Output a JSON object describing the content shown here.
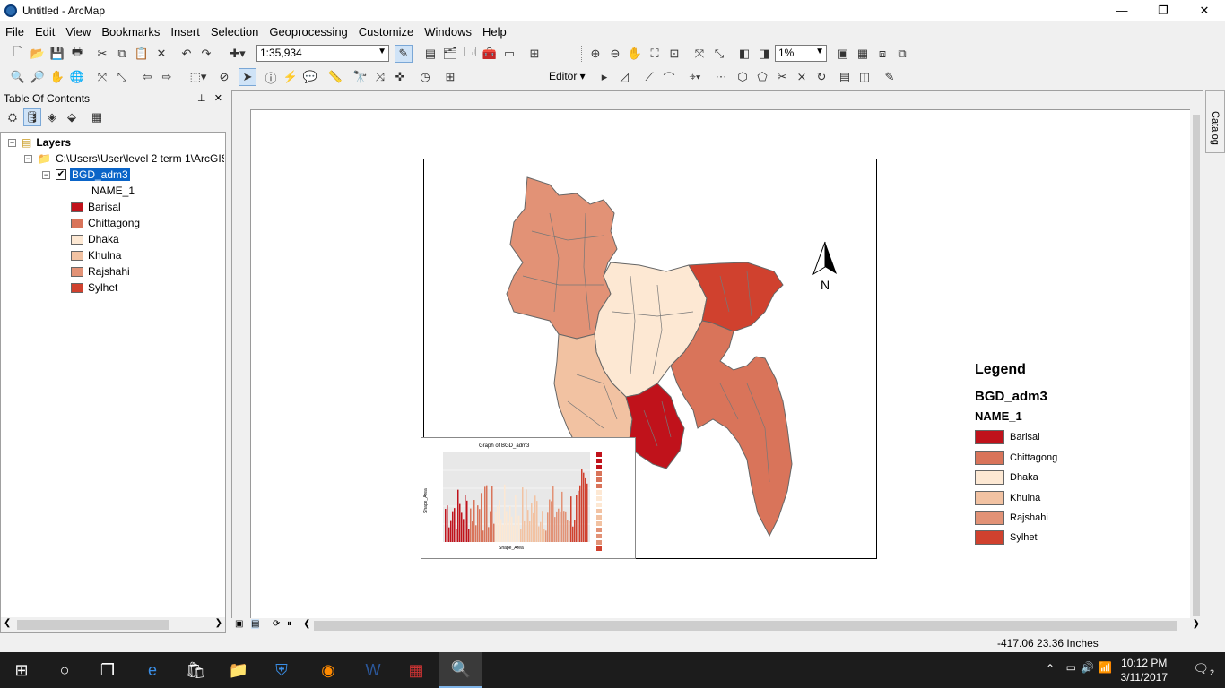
{
  "window": {
    "title": "Untitled - ArcMap",
    "minimize": "—",
    "restore": "❐",
    "close": "✕"
  },
  "menu": [
    "File",
    "Edit",
    "View",
    "Bookmarks",
    "Insert",
    "Selection",
    "Geoprocessing",
    "Customize",
    "Windows",
    "Help"
  ],
  "toolbar": {
    "scale": "1:35,934",
    "zoom_percent": "1%",
    "editor_label": "Editor ▾"
  },
  "toc": {
    "title": "Table Of Contents",
    "layers_label": "Layers",
    "path_label": "C:\\Users\\User\\level 2 term 1\\ArcGIS",
    "layer_name": "BGD_adm3",
    "field_name": "NAME_1",
    "classes": [
      {
        "label": "Barisal",
        "color": "#c0121b"
      },
      {
        "label": "Chittagong",
        "color": "#d9745a"
      },
      {
        "label": "Dhaka",
        "color": "#fde8d3"
      },
      {
        "label": "Khulna",
        "color": "#f2c2a2"
      },
      {
        "label": "Rajshahi",
        "color": "#e29276"
      },
      {
        "label": "Sylhet",
        "color": "#d0412e"
      }
    ]
  },
  "layout": {
    "north_label": "N",
    "legend_title": "Legend",
    "legend_layer": "BGD_adm3",
    "legend_field": "NAME_1",
    "graph_title": "Graph of BGD_adm3",
    "graph_xlabel": "Shape_Area",
    "graph_ylabel": "Shape_Area"
  },
  "catalog_label": "Catalog",
  "status": {
    "coords": "-417.06  23.36 Inches"
  },
  "taskbar": {
    "time": "10:12 PM",
    "date": "3/11/2017",
    "notifications": "2"
  }
}
